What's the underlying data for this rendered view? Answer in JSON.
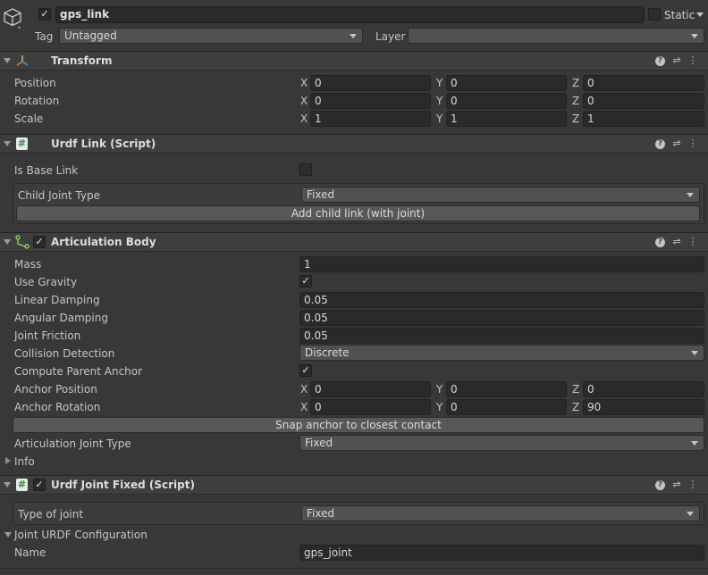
{
  "object": {
    "name": "gps_link",
    "active": true,
    "static_label": "Static",
    "tag_label": "Tag",
    "tag_value": "Untagged",
    "layer_label": "Layer",
    "layer_value": ""
  },
  "transform": {
    "title": "Transform",
    "position": {
      "label": "Position",
      "x": "0",
      "y": "0",
      "z": "0"
    },
    "rotation": {
      "label": "Rotation",
      "x": "0",
      "y": "0",
      "z": "0"
    },
    "scale": {
      "label": "Scale",
      "x": "1",
      "y": "1",
      "z": "1"
    }
  },
  "axis": {
    "x": "X",
    "y": "Y",
    "z": "Z"
  },
  "urdf_link": {
    "title": "Urdf Link (Script)",
    "is_base_label": "Is Base Link",
    "is_base_checked": false,
    "child_joint_label": "Child Joint Type",
    "child_joint_value": "Fixed",
    "add_child_button": "Add child link (with joint)"
  },
  "articulation": {
    "title": "Articulation Body",
    "mass_label": "Mass",
    "mass": "1",
    "gravity_label": "Use Gravity",
    "linear_damping_label": "Linear Damping",
    "linear_damping": "0.05",
    "angular_damping_label": "Angular Damping",
    "angular_damping": "0.05",
    "joint_friction_label": "Joint Friction",
    "joint_friction": "0.05",
    "collision_label": "Collision Detection",
    "collision_value": "Discrete",
    "compute_anchor_label": "Compute Parent Anchor",
    "anchor_position": {
      "label": "Anchor Position",
      "x": "0",
      "y": "0",
      "z": "0"
    },
    "anchor_rotation": {
      "label": "Anchor Rotation",
      "x": "0",
      "y": "0",
      "z": "90"
    },
    "snap_button": "Snap anchor to closest contact",
    "joint_type_label": "Articulation Joint Type",
    "joint_type_value": "Fixed",
    "info_label": "Info"
  },
  "urdf_joint": {
    "title": "Urdf Joint Fixed (Script)",
    "type_label": "Type of joint",
    "type_value": "Fixed",
    "config_label": "Joint URDF Configuration",
    "name_label": "Name",
    "name_value": "gps_joint"
  },
  "icons": {
    "checkmark": "✓",
    "help": "?",
    "settings": "⇌",
    "menu": "⋮",
    "script": "#"
  }
}
